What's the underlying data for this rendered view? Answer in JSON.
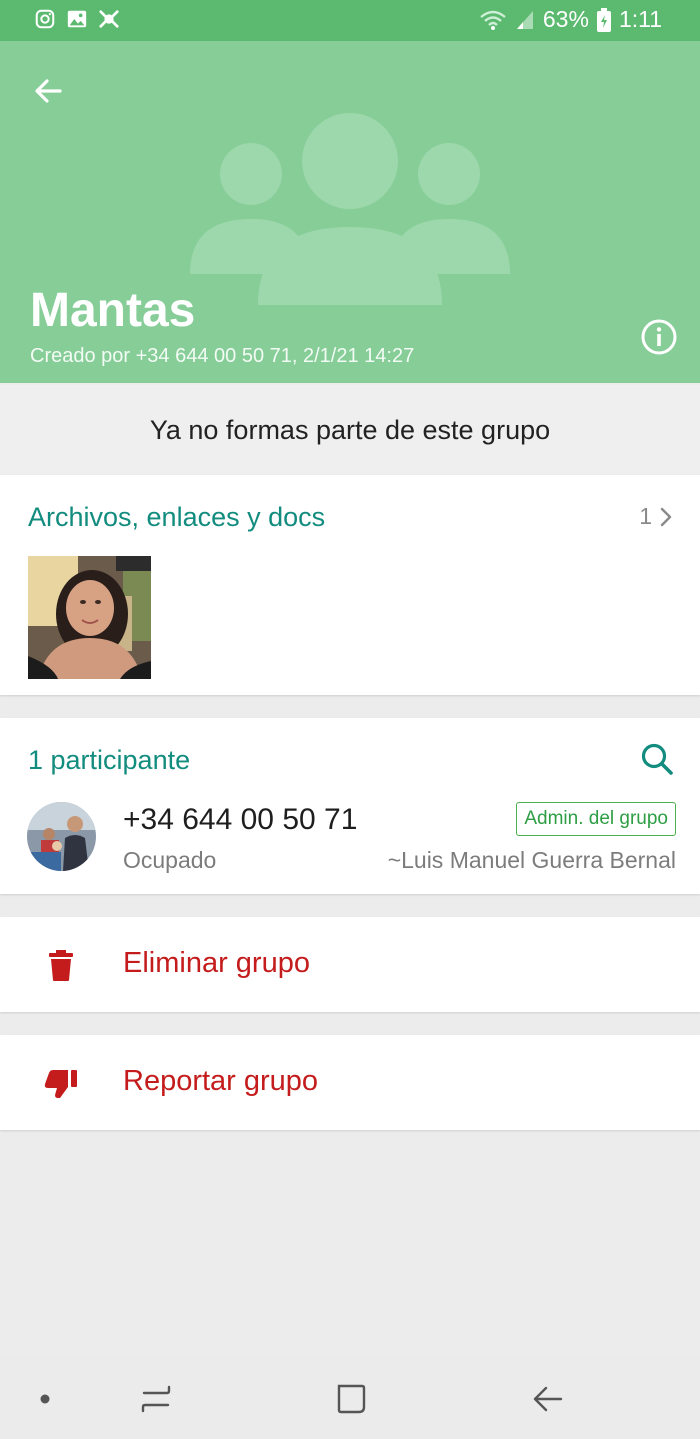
{
  "status_bar": {
    "battery": "63%",
    "time": "1:11",
    "icons": [
      "instagram-icon",
      "gallery-icon",
      "app-icon",
      "wifi-icon",
      "signal-icon",
      "battery-icon"
    ]
  },
  "header": {
    "group_name": "Mantas",
    "created_by": "Creado por +34 644 00 50 71, 2/1/21 14:27",
    "background_color": "#86cd98"
  },
  "notice": "Ya no formas parte de este grupo",
  "media": {
    "title": "Archivos, enlaces y docs",
    "count": "1"
  },
  "participants": {
    "title": "1 participante",
    "items": [
      {
        "number": "+34 644 00 50 71",
        "status": "Ocupado",
        "badge": "Admin. del grupo",
        "name": "~Luis Manuel Guerra Bernal"
      }
    ]
  },
  "actions": {
    "delete": "Eliminar grupo",
    "report": "Reportar grupo"
  },
  "colors": {
    "accent": "#128c7e",
    "danger": "#c41c1c",
    "status_bar": "#5bba6f"
  }
}
